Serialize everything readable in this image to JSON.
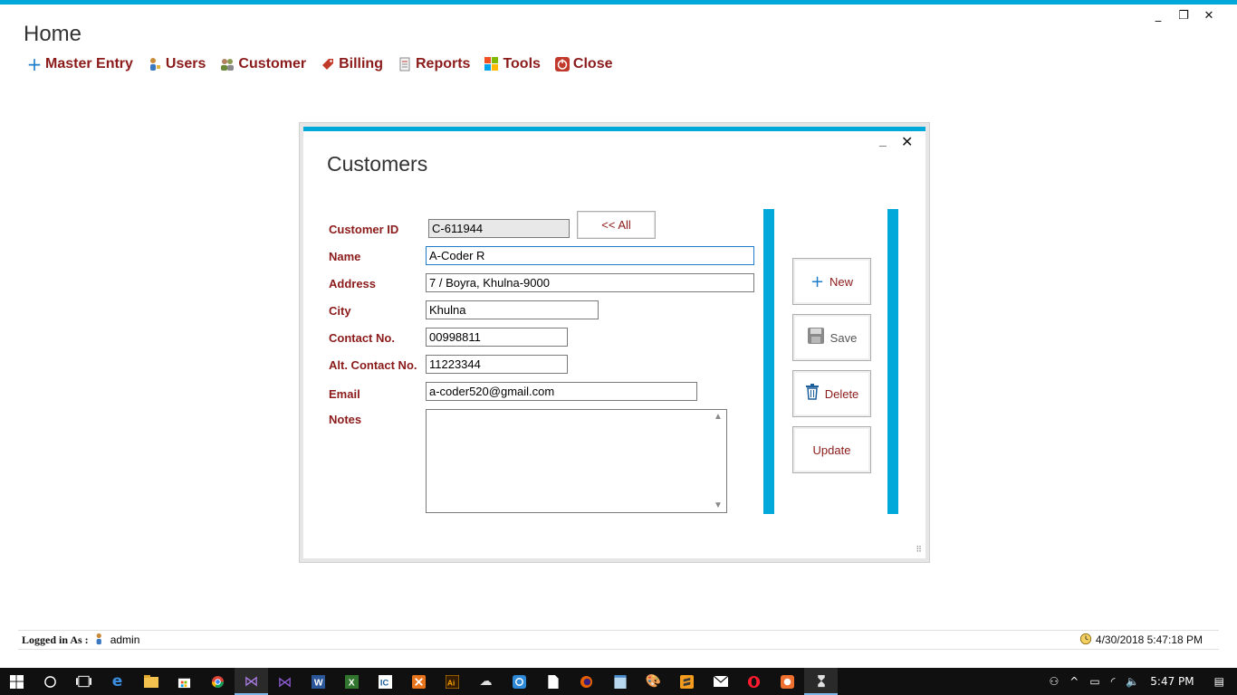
{
  "window": {
    "title": "Home",
    "controls": {
      "minimize": "_",
      "restore": "❐",
      "close": "✕"
    }
  },
  "menu": [
    {
      "name": "master-entry",
      "label": "Master Entry",
      "icon": "plus-icon",
      "glyph": "+",
      "color": "#1e7cc8"
    },
    {
      "name": "users",
      "label": "Users",
      "icon": "user-icon",
      "glyph": "👤",
      "color": "#c07a2a"
    },
    {
      "name": "customer",
      "label": "Customer",
      "icon": "customers-icon",
      "glyph": "👥",
      "color": "#6a8a3a"
    },
    {
      "name": "billing",
      "label": "Billing",
      "icon": "bill-icon",
      "glyph": "🏷",
      "color": "#c0392b"
    },
    {
      "name": "reports",
      "label": "Reports",
      "icon": "report-icon",
      "glyph": "📋",
      "color": "#7a7a7a"
    },
    {
      "name": "tools",
      "label": "Tools",
      "icon": "tools-icon",
      "glyph": "■",
      "color": "#2e8ad8"
    },
    {
      "name": "close",
      "label": "Close",
      "icon": "power-icon",
      "glyph": "⏻",
      "color": "#c0392b"
    }
  ],
  "dialog": {
    "title": "Customers",
    "min": "_",
    "close": "✕",
    "labels": {
      "customer_id": "Customer ID",
      "name": "Name",
      "address": "Address",
      "city": "City",
      "contact": "Contact No.",
      "alt_contact": "Alt. Contact No.",
      "email": "Email",
      "notes": "Notes"
    },
    "values": {
      "customer_id": "C-611944",
      "name": "A-Coder R",
      "address": "7 / Boyra, Khulna-9000",
      "city": "Khulna",
      "contact": "00998811",
      "alt_contact": "11223344",
      "email": "a-coder520@gmail.com",
      "notes": ""
    },
    "all_button": "<< All",
    "buttons": {
      "new": "New",
      "save": "Save",
      "delete": "Delete",
      "update": "Update"
    }
  },
  "status": {
    "logged_in_label": "Logged in As :",
    "user": "admin",
    "datetime": "4/30/2018 5:47:18 PM"
  },
  "taskbar": {
    "time": "5:47 PM"
  },
  "colors": {
    "accent": "#00a9d9",
    "label": "#8b1a1a"
  }
}
